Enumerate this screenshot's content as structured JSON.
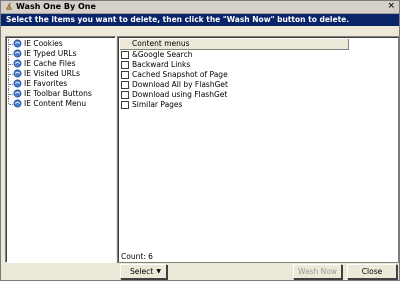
{
  "window": {
    "title": "Wash One By One",
    "close_glyph": "×"
  },
  "banner": {
    "text": "Select the items you want to delete, then click the \"Wash Now\" button to delete."
  },
  "tree": {
    "items": [
      {
        "label": "IE Cookies",
        "icon": "ie-icon"
      },
      {
        "label": "IE Typed URLs",
        "icon": "ie-icon"
      },
      {
        "label": "IE Cache Files",
        "icon": "ie-icon"
      },
      {
        "label": "IE Visited URLs",
        "icon": "ie-icon"
      },
      {
        "label": "IE Favorites",
        "icon": "ie-icon"
      },
      {
        "label": "IE Toolbar Buttons",
        "icon": "ie-icon"
      },
      {
        "label": "IE Content Menu",
        "icon": "ie-icon"
      }
    ]
  },
  "list": {
    "header": "Content menus",
    "items": [
      {
        "label": "&Google Search",
        "checked": false
      },
      {
        "label": "Backward Links",
        "checked": false
      },
      {
        "label": "Cached Snapshot of Page",
        "checked": false
      },
      {
        "label": "Download All by FlashGet",
        "checked": false
      },
      {
        "label": "Download using FlashGet",
        "checked": false
      },
      {
        "label": "Similar Pages",
        "checked": false
      }
    ]
  },
  "footer": {
    "count": "Count: 6",
    "select_label": "Select",
    "select_arrow": "▼",
    "wash_now_label": "Wash Now",
    "close_label": "Close"
  },
  "colors": {
    "banner_bg": "#0a246a",
    "window_bg": "#ece9d8"
  }
}
